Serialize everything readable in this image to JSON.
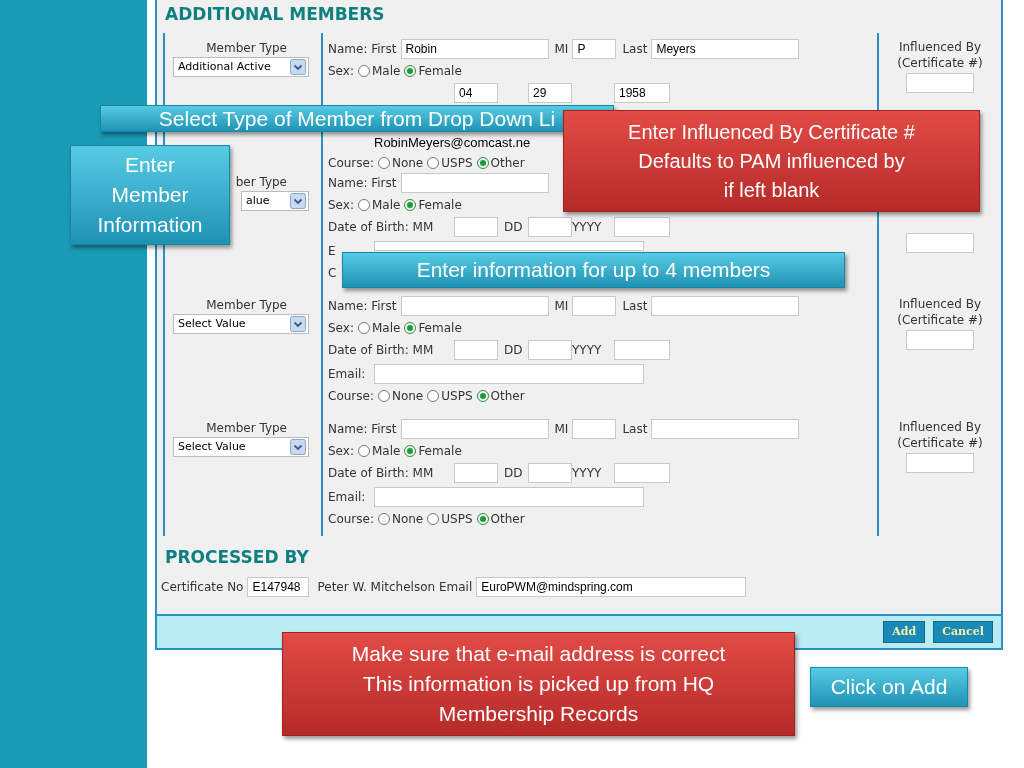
{
  "section_title": "ADDITIONAL MEMBERS",
  "members": [
    {
      "type_label": "Member Type",
      "type_value": "Additional Active",
      "first_label": "Name: First",
      "first": "Robin",
      "name_tail": {
        "mi_label": "MI",
        "mi": "P",
        "last_label": "Last",
        "last": "Meyers"
      },
      "sex_label": "Sex:",
      "sex": [
        {
          "label": "Male",
          "selected": false
        },
        {
          "label": "Female",
          "selected": true
        }
      ],
      "dob": {
        "mm": "04",
        "dd": "29",
        "yyyy": "1958"
      },
      "email": "RobinMeyers@comcast.ne",
      "course_label": "Course:",
      "course": [
        {
          "label": "None",
          "selected": false
        },
        {
          "label": "USPS",
          "selected": false
        },
        {
          "label": "Other",
          "selected": true
        }
      ],
      "influenced_label": "Influenced By (Certificate #)"
    },
    {
      "type_label": "ber Type",
      "type_value": "alue",
      "first_label": "Name: First",
      "sex_label": "Sex:",
      "sex": [
        {
          "label": "Male",
          "selected": false
        },
        {
          "label": "Female",
          "selected": true
        }
      ],
      "dob": {
        "label": "Date of Birth: MM",
        "dd_label": "DD",
        "yyyy_label": "YYYY"
      },
      "email_label": "E",
      "course_label": "C"
    },
    {
      "type_label": "Member Type",
      "type_value": "Select Value",
      "first_label": "Name: First",
      "name_tail": {
        "mi_label": "MI",
        "last_label": "Last"
      },
      "sex_label": "Sex:",
      "sex": [
        {
          "label": "Male",
          "selected": false
        },
        {
          "label": "Female",
          "selected": true
        }
      ],
      "dob": {
        "label": "Date of Birth: MM",
        "dd_label": "DD",
        "yyyy_label": "YYYY"
      },
      "email_label": "Email:",
      "course_label": "Course:",
      "course": [
        {
          "label": "None",
          "selected": false
        },
        {
          "label": "USPS",
          "selected": false
        },
        {
          "label": "Other",
          "selected": true
        }
      ],
      "influenced_label": "Influenced By (Certificate #)"
    },
    {
      "type_label": "Member Type",
      "type_value": "Select Value",
      "first_label": "Name: First",
      "name_tail": {
        "mi_label": "MI",
        "last_label": "Last"
      },
      "sex_label": "Sex:",
      "sex": [
        {
          "label": "Male",
          "selected": false
        },
        {
          "label": "Female",
          "selected": true
        }
      ],
      "dob": {
        "label": "Date of Birth: MM",
        "dd_label": "DD",
        "yyyy_label": "YYYY"
      },
      "email_label": "Email:",
      "course_label": "Course:",
      "course": [
        {
          "label": "None",
          "selected": false
        },
        {
          "label": "USPS",
          "selected": false
        },
        {
          "label": "Other",
          "selected": true
        }
      ],
      "influenced_label": "Influenced By (Certificate #)"
    }
  ],
  "processed_by": {
    "title": "PROCESSED BY",
    "certificate_label": "Certificate No",
    "certificate": "E147948",
    "email_label": "Peter W. Mitchelson Email",
    "email": "EuroPWM@mindspring.com"
  },
  "buttons": [
    "Add",
    "Cancel"
  ],
  "callouts": [
    {
      "kind": "info",
      "lines": [
        "Select Type of Member from Drop Down Li"
      ]
    },
    {
      "kind": "warning",
      "lines": [
        "Enter Influenced By Certificate #",
        "Defaults to PAM influenced by",
        "if left blank"
      ]
    },
    {
      "kind": "info",
      "lines": [
        "Enter",
        "Member",
        "Information"
      ]
    },
    {
      "kind": "info",
      "lines": [
        "Enter information for up to 4 members"
      ]
    },
    {
      "kind": "warning",
      "lines": [
        "Make sure that e-mail address is correct",
        "This information is picked up from HQ",
        "Membership Records"
      ]
    },
    {
      "kind": "info",
      "lines": [
        "Click on Add"
      ]
    }
  ]
}
